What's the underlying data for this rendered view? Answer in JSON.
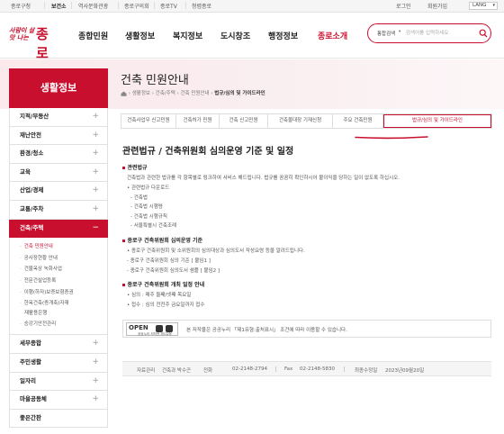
{
  "topbar": {
    "links": [
      "종로구청",
      "보건소",
      "역사문화관광",
      "종로구의회",
      "종로TV",
      "청렴종로"
    ],
    "active_index": 1,
    "utility": [
      "로그인",
      "회원가입"
    ],
    "lang": "LANG"
  },
  "header": {
    "logo_small": "사람이 살맛 나는",
    "logo_big": "종로",
    "nav": [
      "종합민원",
      "생활정보",
      "복지정보",
      "도시창조",
      "행정정보",
      "종로소개"
    ],
    "nav_active": 5,
    "search": {
      "scope": "통합검색",
      "placeholder": "검색어를 입력하세요."
    }
  },
  "sidebar": {
    "title": "생활정보",
    "items": [
      {
        "label": "지적/부동산",
        "icon": "plus-icon"
      },
      {
        "label": "재난안전",
        "icon": "plus-icon"
      },
      {
        "label": "환경/청소",
        "icon": "plus-icon"
      },
      {
        "label": "교육",
        "icon": "plus-icon"
      },
      {
        "label": "산업/경제",
        "icon": "plus-icon"
      },
      {
        "label": "교통/주차",
        "icon": "plus-icon"
      },
      {
        "label": "건축/주택",
        "icon": "minus-icon"
      },
      {
        "label": "세무종합",
        "icon": "plus-icon"
      },
      {
        "label": "주민생활",
        "icon": "plus-icon"
      },
      {
        "label": "일자리",
        "icon": "plus-icon"
      },
      {
        "label": "마을공동체",
        "icon": "plus-icon"
      },
      {
        "label": "좋은간판",
        "icon": ""
      }
    ],
    "open_index": 6,
    "submenu": [
      "건축 민원안내",
      "공사장현황 안내",
      "건물옥상 녹화사업",
      "전문건설업등록",
      "이행(하자)보증보험증권",
      "한옥건축(증개축)자재",
      "재활용은행",
      "승강기안전관리"
    ],
    "submenu_active": 0
  },
  "page": {
    "title": "건축 민원안내",
    "breadcrumb": [
      "생활정보",
      "건축/주택",
      "건축 민원안내",
      "법규/심의 및 가이드라인"
    ],
    "tabs": [
      "건축사업무 신고민원",
      "건축허가 민원",
      "건축 신고민원",
      "건축물대장 기재신청",
      "주요 건축민원",
      "법규/심의 및 가이드라인"
    ],
    "active_tab": 5,
    "content_title": "관련법규 / 건축위원회 심의운영 기준 및 일정",
    "sections": [
      {
        "heading": "관련법규",
        "lines": [
          "건축법과 관련한 법규를 각 항목별로 링크하여 서비스 해드립니다. 법규를 꼼꼼히 확인하시어 불이익을 당하는 일이 없도록 하십시오.",
          "• 관련법규 다운로드",
          "- 건축법",
          "- 건축법 시행령",
          "- 건축법 시행규칙",
          "- 서울특별시 건축조례"
        ]
      },
      {
        "heading": "종로구 건축위원회 심의운영 기준",
        "lines": [
          "• 종로구 건축위원회 및 소위원회의 심의대상과 심의도서 작성요령 등을 알려드립니다.",
          "- 종로구 건축위원회 심의 기준 [ 붙임1 ]",
          "- 종로구 건축위원회 심의도서 샘플 [ 붙임2 ]"
        ]
      },
      {
        "heading": "종로구 건축위원회 개최 일정 안내",
        "lines": [
          "• 심의 : 매주 둘째/넷째 목요일",
          "• 접수 : 심의 전전주 금요일까지 접수"
        ]
      }
    ],
    "kogl": {
      "open_label": "OPEN",
      "caption": "공공누리 저작권 제1유형",
      "notice": "본 저작물은 공공누리 「제1유형:출처표시」 조건에 따라 이용할 수 있습니다."
    },
    "footer": {
      "dept_label": "자료관리",
      "dept": "건축과 박수곤",
      "phone_label": "전화",
      "phone": "02-2148-2794",
      "fax_label": "Fax",
      "fax": "02-2148-5830",
      "updated_label": "최종수정일",
      "updated": "2023년09월20일"
    }
  },
  "colors": {
    "brand": "#c8102e",
    "banner": "#fbe9ec"
  }
}
